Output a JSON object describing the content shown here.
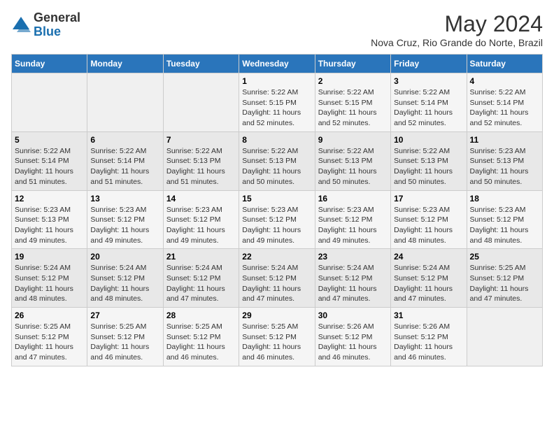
{
  "logo": {
    "general": "General",
    "blue": "Blue"
  },
  "title": {
    "month_year": "May 2024",
    "location": "Nova Cruz, Rio Grande do Norte, Brazil"
  },
  "days_of_week": [
    "Sunday",
    "Monday",
    "Tuesday",
    "Wednesday",
    "Thursday",
    "Friday",
    "Saturday"
  ],
  "weeks": [
    [
      {
        "day": "",
        "info": ""
      },
      {
        "day": "",
        "info": ""
      },
      {
        "day": "",
        "info": ""
      },
      {
        "day": "1",
        "info": "Sunrise: 5:22 AM\nSunset: 5:15 PM\nDaylight: 11 hours\nand 52 minutes."
      },
      {
        "day": "2",
        "info": "Sunrise: 5:22 AM\nSunset: 5:15 PM\nDaylight: 11 hours\nand 52 minutes."
      },
      {
        "day": "3",
        "info": "Sunrise: 5:22 AM\nSunset: 5:14 PM\nDaylight: 11 hours\nand 52 minutes."
      },
      {
        "day": "4",
        "info": "Sunrise: 5:22 AM\nSunset: 5:14 PM\nDaylight: 11 hours\nand 52 minutes."
      }
    ],
    [
      {
        "day": "5",
        "info": "Sunrise: 5:22 AM\nSunset: 5:14 PM\nDaylight: 11 hours\nand 51 minutes."
      },
      {
        "day": "6",
        "info": "Sunrise: 5:22 AM\nSunset: 5:14 PM\nDaylight: 11 hours\nand 51 minutes."
      },
      {
        "day": "7",
        "info": "Sunrise: 5:22 AM\nSunset: 5:13 PM\nDaylight: 11 hours\nand 51 minutes."
      },
      {
        "day": "8",
        "info": "Sunrise: 5:22 AM\nSunset: 5:13 PM\nDaylight: 11 hours\nand 50 minutes."
      },
      {
        "day": "9",
        "info": "Sunrise: 5:22 AM\nSunset: 5:13 PM\nDaylight: 11 hours\nand 50 minutes."
      },
      {
        "day": "10",
        "info": "Sunrise: 5:22 AM\nSunset: 5:13 PM\nDaylight: 11 hours\nand 50 minutes."
      },
      {
        "day": "11",
        "info": "Sunrise: 5:23 AM\nSunset: 5:13 PM\nDaylight: 11 hours\nand 50 minutes."
      }
    ],
    [
      {
        "day": "12",
        "info": "Sunrise: 5:23 AM\nSunset: 5:13 PM\nDaylight: 11 hours\nand 49 minutes."
      },
      {
        "day": "13",
        "info": "Sunrise: 5:23 AM\nSunset: 5:12 PM\nDaylight: 11 hours\nand 49 minutes."
      },
      {
        "day": "14",
        "info": "Sunrise: 5:23 AM\nSunset: 5:12 PM\nDaylight: 11 hours\nand 49 minutes."
      },
      {
        "day": "15",
        "info": "Sunrise: 5:23 AM\nSunset: 5:12 PM\nDaylight: 11 hours\nand 49 minutes."
      },
      {
        "day": "16",
        "info": "Sunrise: 5:23 AM\nSunset: 5:12 PM\nDaylight: 11 hours\nand 49 minutes."
      },
      {
        "day": "17",
        "info": "Sunrise: 5:23 AM\nSunset: 5:12 PM\nDaylight: 11 hours\nand 48 minutes."
      },
      {
        "day": "18",
        "info": "Sunrise: 5:23 AM\nSunset: 5:12 PM\nDaylight: 11 hours\nand 48 minutes."
      }
    ],
    [
      {
        "day": "19",
        "info": "Sunrise: 5:24 AM\nSunset: 5:12 PM\nDaylight: 11 hours\nand 48 minutes."
      },
      {
        "day": "20",
        "info": "Sunrise: 5:24 AM\nSunset: 5:12 PM\nDaylight: 11 hours\nand 48 minutes."
      },
      {
        "day": "21",
        "info": "Sunrise: 5:24 AM\nSunset: 5:12 PM\nDaylight: 11 hours\nand 47 minutes."
      },
      {
        "day": "22",
        "info": "Sunrise: 5:24 AM\nSunset: 5:12 PM\nDaylight: 11 hours\nand 47 minutes."
      },
      {
        "day": "23",
        "info": "Sunrise: 5:24 AM\nSunset: 5:12 PM\nDaylight: 11 hours\nand 47 minutes."
      },
      {
        "day": "24",
        "info": "Sunrise: 5:24 AM\nSunset: 5:12 PM\nDaylight: 11 hours\nand 47 minutes."
      },
      {
        "day": "25",
        "info": "Sunrise: 5:25 AM\nSunset: 5:12 PM\nDaylight: 11 hours\nand 47 minutes."
      }
    ],
    [
      {
        "day": "26",
        "info": "Sunrise: 5:25 AM\nSunset: 5:12 PM\nDaylight: 11 hours\nand 47 minutes."
      },
      {
        "day": "27",
        "info": "Sunrise: 5:25 AM\nSunset: 5:12 PM\nDaylight: 11 hours\nand 46 minutes."
      },
      {
        "day": "28",
        "info": "Sunrise: 5:25 AM\nSunset: 5:12 PM\nDaylight: 11 hours\nand 46 minutes."
      },
      {
        "day": "29",
        "info": "Sunrise: 5:25 AM\nSunset: 5:12 PM\nDaylight: 11 hours\nand 46 minutes."
      },
      {
        "day": "30",
        "info": "Sunrise: 5:26 AM\nSunset: 5:12 PM\nDaylight: 11 hours\nand 46 minutes."
      },
      {
        "day": "31",
        "info": "Sunrise: 5:26 AM\nSunset: 5:12 PM\nDaylight: 11 hours\nand 46 minutes."
      },
      {
        "day": "",
        "info": ""
      }
    ]
  ]
}
